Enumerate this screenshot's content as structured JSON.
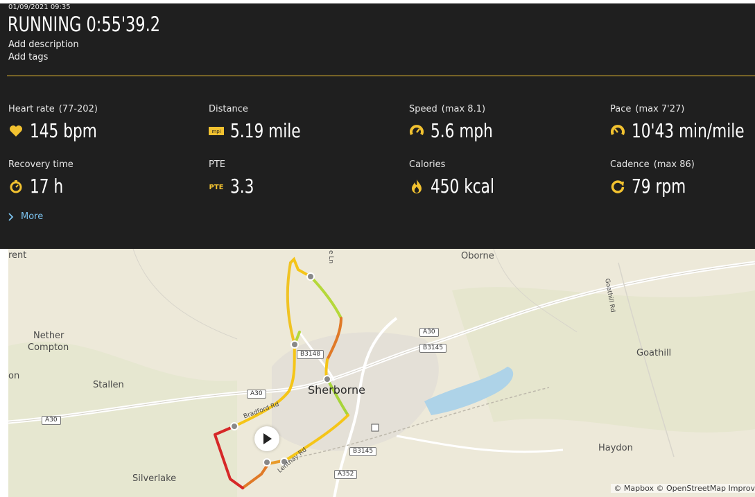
{
  "header": {
    "timestamp": "01/09/2021 09:35",
    "title": "RUNNING  0:55'39.2",
    "add_description": "Add description",
    "add_tags": "Add tags"
  },
  "colors": {
    "accent": "#f2c230",
    "panel_bg": "#1f1f1f",
    "link": "#7cc3ef"
  },
  "stats": [
    {
      "label": "Heart rate",
      "extra": "(77-202)",
      "value": "145 bpm",
      "icon": "heart-icon"
    },
    {
      "label": "Distance",
      "extra": "",
      "value": "5.19 mile",
      "icon": "ruler-icon"
    },
    {
      "label": "Speed",
      "extra": "(max  8.1)",
      "value": "5.6 mph",
      "icon": "speedometer-icon"
    },
    {
      "label": "Pace",
      "extra": "(max  7'27)",
      "value": "10'43 min/mile",
      "icon": "speedometer-icon"
    },
    {
      "label": "Recovery time",
      "extra": "",
      "value": "17 h",
      "icon": "timer-icon"
    },
    {
      "label": "PTE",
      "extra": "",
      "value": "3.3",
      "icon": "pte-icon"
    },
    {
      "label": "Calories",
      "extra": "",
      "value": "450 kcal",
      "icon": "flame-icon"
    },
    {
      "label": "Cadence",
      "extra": "(max  86)",
      "value": "79 rpm",
      "icon": "cycle-icon"
    }
  ],
  "more_link": "More",
  "map": {
    "labels": {
      "rent": "rent",
      "oborne": "Oborne",
      "nether_compton_1": "Nether",
      "nether_compton_2": "Compton",
      "on": "on",
      "stallen": "Stallen",
      "sherborne": "Sherborne",
      "goathill": "Goathill",
      "goathill_rd": "Goathill Rd",
      "haydon": "Haydon",
      "silverlake": "Silverlake",
      "bradford_rd": "Bradford Rd",
      "lenthay_rd": "Lenthay Rd",
      "lane_ln": "e Ln"
    },
    "roads": [
      "A30",
      "B3148",
      "B3145",
      "A30",
      "A30",
      "B3145",
      "A352"
    ],
    "attribution": "© Mapbox © OpenStreetMap  Improv",
    "pte_icon_text": "PTE",
    "distance_icon_text": "mpi"
  }
}
